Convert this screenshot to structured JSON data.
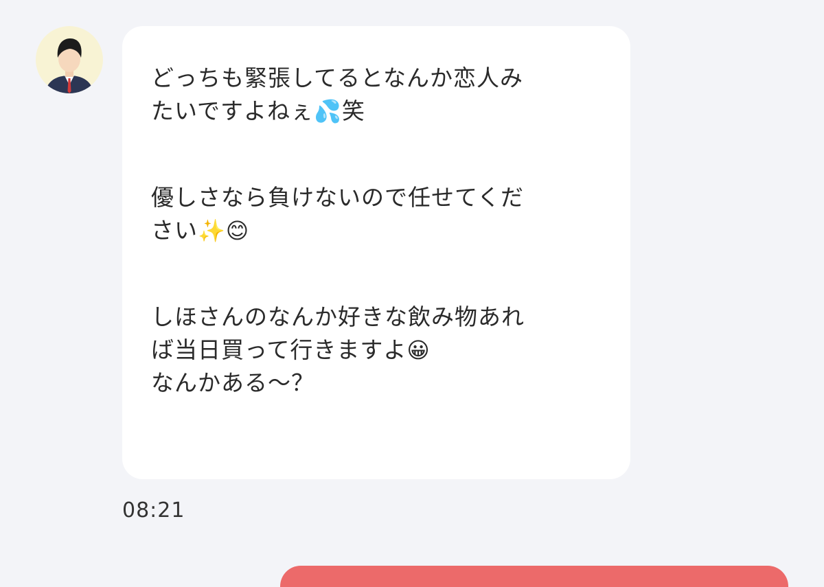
{
  "incoming_message": {
    "avatar_icon": "person-avatar-icon",
    "paragraph1": {
      "line1": "どっちも緊張してるとなんか恋人み",
      "line2_text": "たいですよねぇ",
      "line2_emoji": "💦",
      "line2_tail": "笑"
    },
    "paragraph2": {
      "line1": "優しさなら負けないので任せてくだ",
      "line2_text": "さい",
      "line2_emoji1": "✨",
      "line2_emoji2": "😊"
    },
    "paragraph3": {
      "line1": "しほさんのなんか好きな飲み物あれ",
      "line2_text": "ば当日買って行きますよ",
      "line2_emoji": "😀",
      "line3": "なんかある～？"
    },
    "time": "08:21"
  },
  "colors": {
    "background": "#f3f4f8",
    "incoming_bubble": "#ffffff",
    "outgoing_bubble": "#ec6a6a",
    "avatar_bg": "#f8f3d4"
  }
}
